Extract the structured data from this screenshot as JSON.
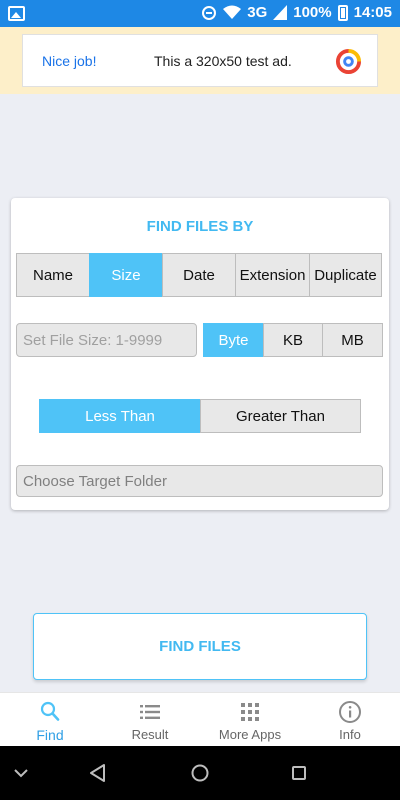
{
  "status_bar": {
    "network": "3G",
    "battery": "100%",
    "time": "14:05"
  },
  "ad": {
    "headline": "Nice job!",
    "message": "This a 320x50 test ad."
  },
  "card": {
    "title": "FIND FILES BY",
    "find_by_options": [
      "Name",
      "Size",
      "Date",
      "Extension",
      "Duplicate"
    ],
    "find_by_selected": "Size",
    "size_input": {
      "value": "",
      "placeholder": "Set File Size: 1-9999"
    },
    "unit_options": [
      "Byte",
      "KB",
      "MB"
    ],
    "unit_selected": "Byte",
    "compare_options": [
      "Less Than",
      "Greater Than"
    ],
    "compare_selected": "Less Than",
    "folder_placeholder": "Choose Target Folder"
  },
  "find_button": "FIND FILES",
  "bottom_nav": [
    {
      "label": "Find",
      "icon": "search-icon",
      "active": true
    },
    {
      "label": "Result",
      "icon": "list-icon",
      "active": false
    },
    {
      "label": "More Apps",
      "icon": "apps-grid-icon",
      "active": false
    },
    {
      "label": "Info",
      "icon": "info-icon",
      "active": false
    }
  ],
  "colors": {
    "status_bar": "#1e88e5",
    "accent": "#4fc3f7",
    "accent_text": "#42b9f1",
    "ad_background": "#fdefc9"
  }
}
